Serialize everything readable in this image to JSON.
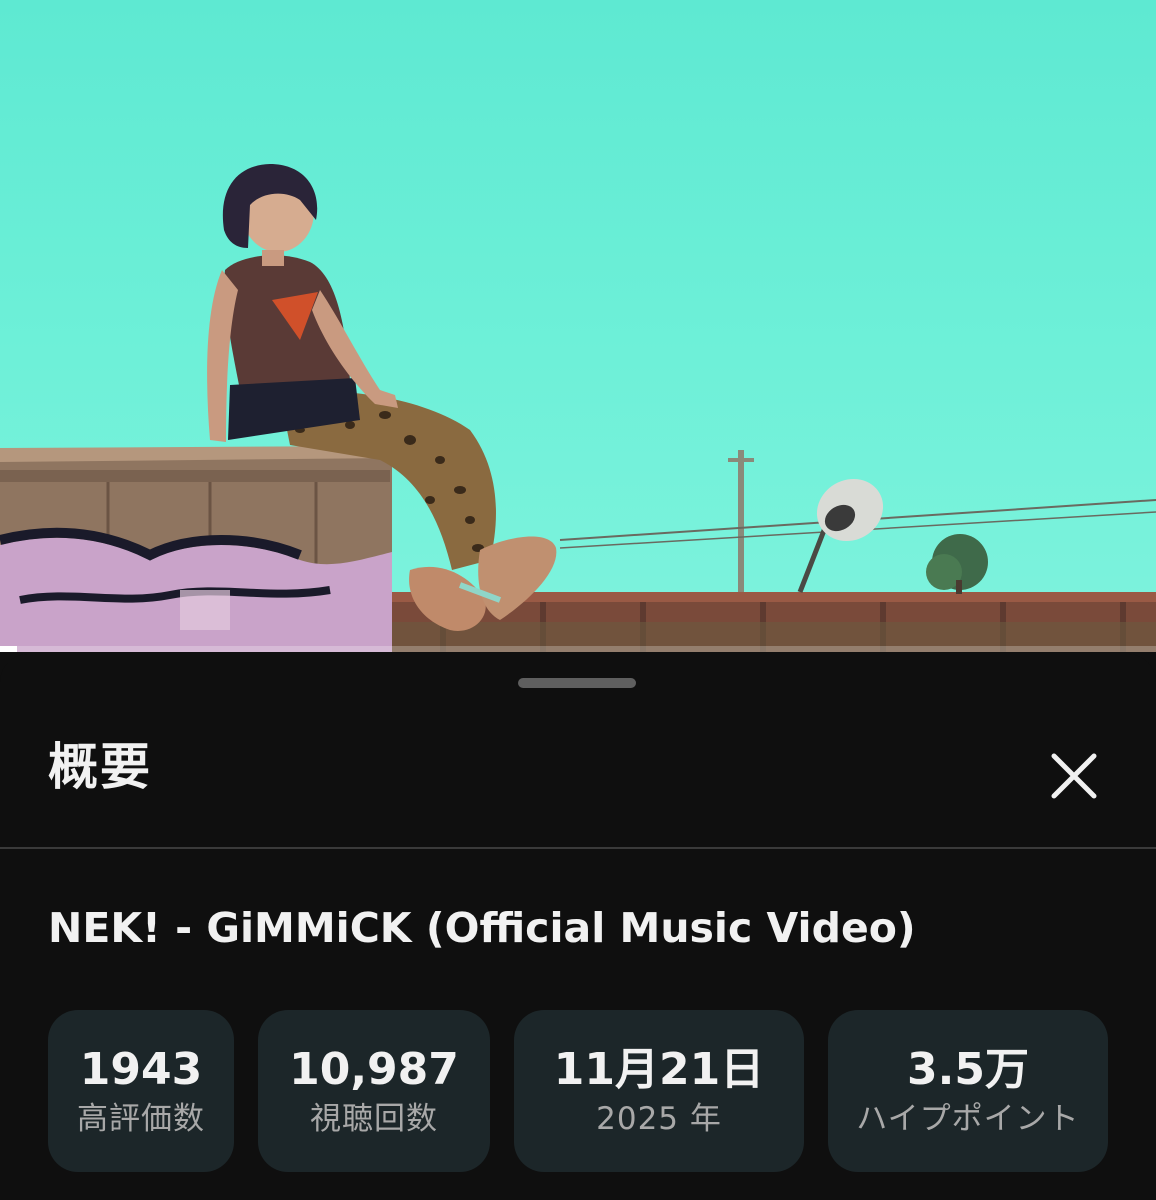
{
  "video": {
    "progress": 0.015
  },
  "sheet": {
    "title": "概要",
    "close_icon": "close-icon",
    "video_title": "NEK! - GiMMiCK (Official Music Video)",
    "stats": [
      {
        "value": "1943",
        "label": "高評価数"
      },
      {
        "value": "10,987",
        "label": "視聴回数"
      },
      {
        "value": "11月21日",
        "label": "2025 年"
      },
      {
        "value": "3.5万",
        "label": "ハイプポイント"
      }
    ]
  },
  "colors": {
    "background": "#0f0f0f",
    "stat_card": "#1c2629",
    "sky": "#6ef0d8"
  }
}
